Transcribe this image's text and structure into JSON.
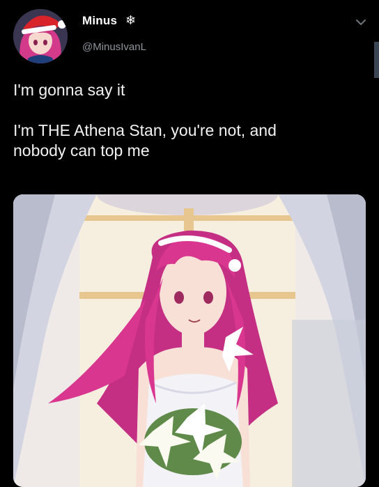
{
  "tweet": {
    "author": {
      "display_name": "Minus",
      "name_emoji": "❄",
      "handle": "@MinusIvanL"
    },
    "text_lines": [
      "I'm gonna say it",
      "",
      "I'm THE Athena Stan, you're not, and",
      "nobody can top me"
    ]
  },
  "icons": {
    "menu": "chevron-down-icon",
    "badge": "snowflake-icon"
  },
  "colors": {
    "background": "#000000",
    "text": "#f2f2f2",
    "handle": "#8e969c",
    "hair": "#d9368f"
  }
}
